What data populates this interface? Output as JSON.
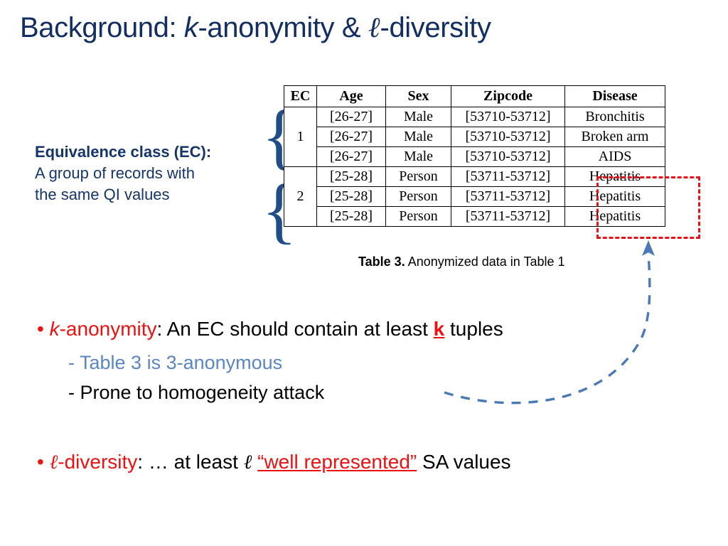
{
  "slide": {
    "title_prefix": "Background: ",
    "title_k": "k",
    "title_mid": "-anonymity & ",
    "title_l": "ℓ",
    "title_suffix": "-diversity"
  },
  "annotation": {
    "heading": "Equivalence class (EC):",
    "line1": "A group of records with",
    "line2": "the same QI values",
    "brace_ec1": "{",
    "brace_ec2": "{"
  },
  "table": {
    "headers": [
      "EC",
      "Age",
      "Sex",
      "Zipcode",
      "Disease"
    ],
    "groups": [
      {
        "ec": "1",
        "rows": [
          [
            "[26-27]",
            "Male",
            "[53710-53712]",
            "Bronchitis"
          ],
          [
            "[26-27]",
            "Male",
            "[53710-53712]",
            "Broken arm"
          ],
          [
            "[26-27]",
            "Male",
            "[53710-53712]",
            "AIDS"
          ]
        ]
      },
      {
        "ec": "2",
        "rows": [
          [
            "[25-28]",
            "Person",
            "[53711-53712]",
            "Hepatitis"
          ],
          [
            "[25-28]",
            "Person",
            "[53711-53712]",
            "Hepatitis"
          ],
          [
            "[25-28]",
            "Person",
            "[53711-53712]",
            "Hepatitis"
          ]
        ]
      }
    ],
    "highlight_color": "#E8121B"
  },
  "caption": {
    "label": "Table 3.",
    "text": " Anonymized data in Table 1"
  },
  "bullets": {
    "k_anonymity": {
      "marker": "•",
      "term_k": "k",
      "term_rest": "-anonymity",
      "body_before": ": An EC should contain at least ",
      "highlight": "k",
      "body_after": " tuples"
    },
    "sub_1": "- Table 3 is 3-anonymous",
    "sub_2": "- Prone to homogeneity attack",
    "l_diversity": {
      "marker": "•",
      "term_l": "ℓ",
      "term_rest": "-diversity",
      "body_before": ": … at least ",
      "mid_l": "ℓ",
      "quote": "“well represented”",
      "body_after": " SA values"
    }
  },
  "colors": {
    "title_navy": "#132E62",
    "annotation_navy": "#15356B",
    "accent_red": "#EE1111",
    "sub_blue": "#5B86C4",
    "arrow_blue": "#4A7AB5"
  }
}
